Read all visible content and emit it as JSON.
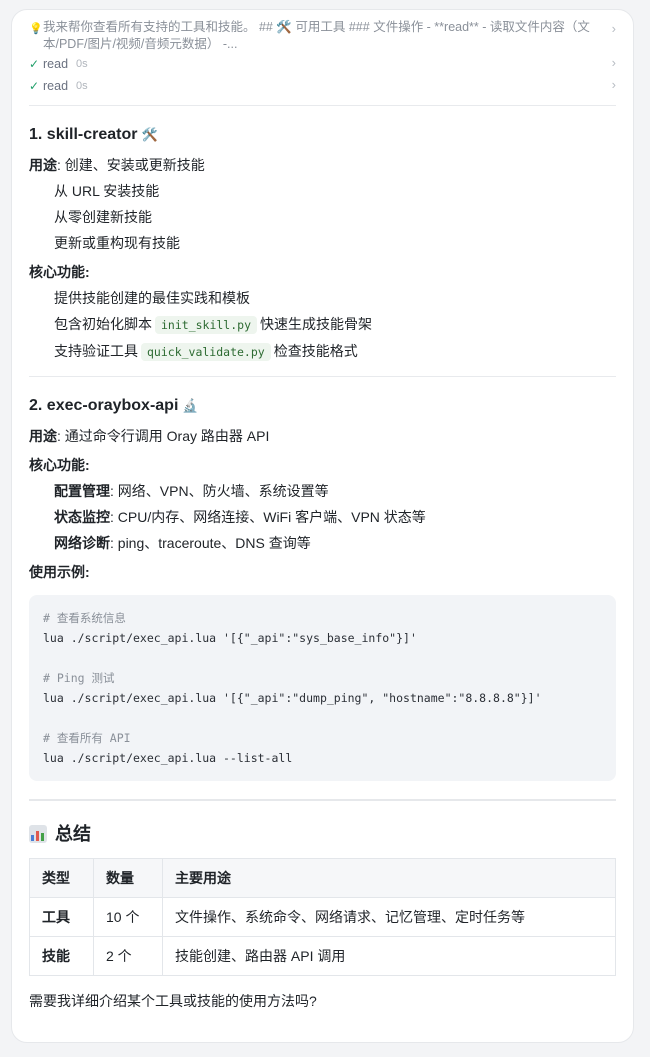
{
  "thinking": {
    "icon": "lightbulb-icon",
    "summary": "我来帮你查看所有支持的工具和技能。 ## 🛠️ 可用工具 ### 文件操作 - **read** - 读取文件内容（文本/PDF/图片/视频/音频元数据） -...",
    "tools": [
      {
        "name": "read",
        "duration": "0s"
      },
      {
        "name": "read",
        "duration": "0s"
      }
    ]
  },
  "skills": [
    {
      "title": "1. skill-creator",
      "emoji": "🛠️",
      "usage_label": "用途",
      "usage": ": 创建、安装或更新技能",
      "items": [
        "从 URL 安装技能",
        "从零创建新技能",
        "更新或重构现有技能"
      ],
      "core_label": "核心功能",
      "core": [
        {
          "pre": "提供技能创建的最佳实践和模板",
          "code": "",
          "post": ""
        },
        {
          "pre": "包含初始化脚本",
          "code": "init_skill.py",
          "post": "快速生成技能骨架"
        },
        {
          "pre": "支持验证工具",
          "code": "quick_validate.py",
          "post": "检查技能格式"
        }
      ]
    },
    {
      "title": "2. exec-oraybox-api",
      "emoji": "🔬",
      "usage_label": "用途",
      "usage": ": 通过命令行调用 Oray 路由器 API",
      "core_label": "核心功能",
      "core": [
        {
          "bold": "配置管理",
          "text": ": 网络、VPN、防火墙、系统设置等"
        },
        {
          "bold": "状态监控",
          "text": ": CPU/内存、网络连接、WiFi 客户端、VPN 状态等"
        },
        {
          "bold": "网络诊断",
          "text": ": ping、traceroute、DNS 查询等"
        }
      ],
      "example_label": "使用示例",
      "code_lines": [
        {
          "t": "# 查看系统信息",
          "c": true
        },
        {
          "t": "lua ./script/exec_api.lua '[{\"_api\":\"sys_base_info\"}]'",
          "c": false
        },
        {
          "t": "",
          "c": false
        },
        {
          "t": "# Ping 测试",
          "c": true
        },
        {
          "t": "lua ./script/exec_api.lua '[{\"_api\":\"dump_ping\", \"hostname\":\"8.8.8.8\"}]'",
          "c": false
        },
        {
          "t": "",
          "c": false
        },
        {
          "t": "# 查看所有 API",
          "c": true
        },
        {
          "t": "lua ./script/exec_api.lua --list-all",
          "c": false
        }
      ]
    }
  ],
  "summary": {
    "title": "总结",
    "icon": "bar-chart-icon",
    "headers": [
      "类型",
      "数量",
      "主要用途"
    ],
    "rows": [
      [
        "工具",
        "10 个",
        "文件操作、系统命令、网络请求、记忆管理、定时任务等"
      ],
      [
        "技能",
        "2 个",
        "技能创建、路由器 API 调用"
      ]
    ]
  },
  "closing": "需要我详细介绍某个工具或技能的使用方法吗?"
}
